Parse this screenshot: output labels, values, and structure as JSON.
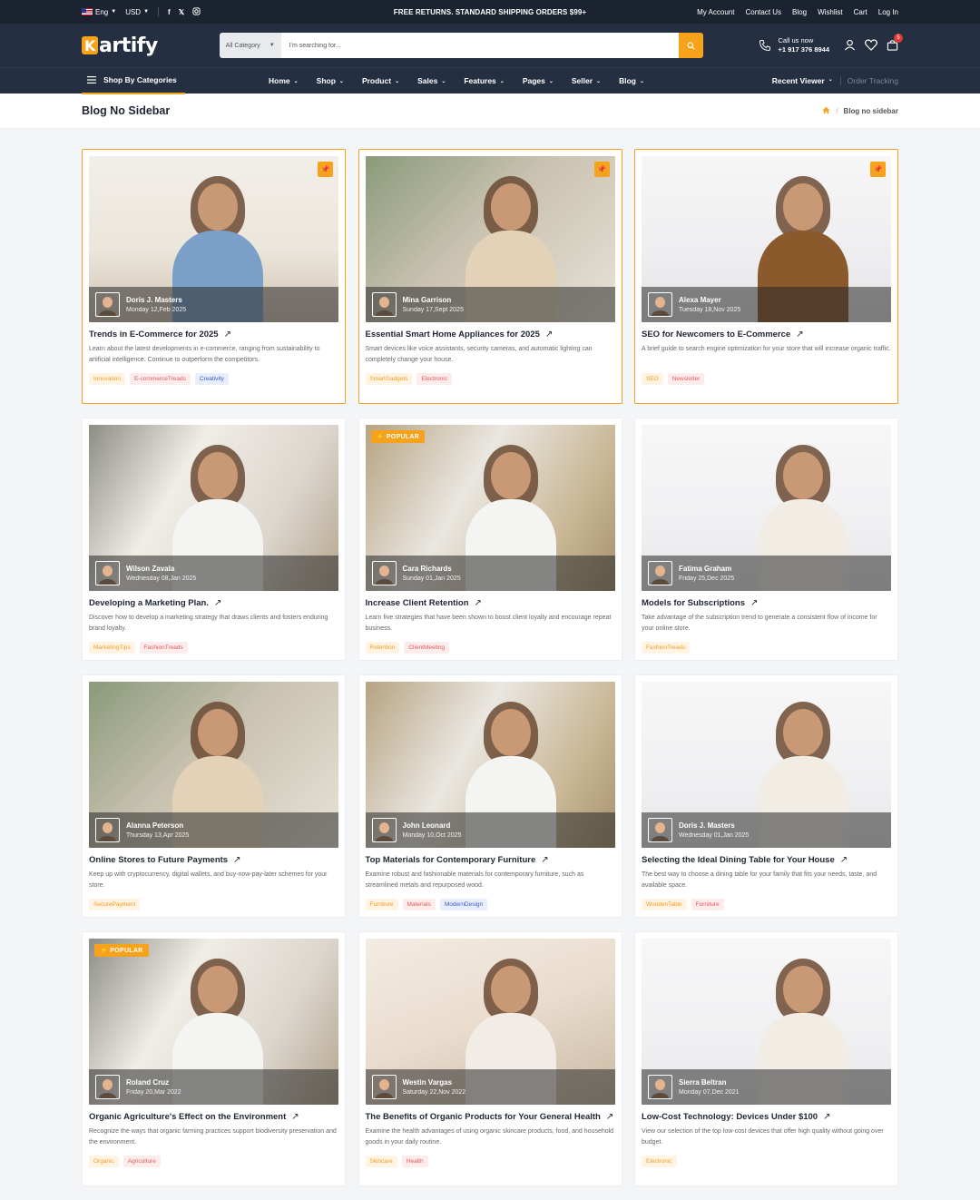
{
  "topbar": {
    "language": "Eng",
    "currency": "USD",
    "promo": "FREE RETURNS. STANDARD SHIPPING ORDERS $99+",
    "links": [
      "My Account",
      "Contact Us",
      "Blog",
      "Wishlist",
      "Cart",
      "Log In"
    ]
  },
  "header": {
    "logo_initial": "K",
    "logo_rest": "artify",
    "search": {
      "category": "All Category",
      "placeholder": "I'm searching for..."
    },
    "call": {
      "label": "Call us now",
      "phone": "+1 917 376 8944"
    },
    "cart_count": "5"
  },
  "nav": {
    "shop_by": "Shop By Categories",
    "items": [
      "Home",
      "Shop",
      "Product",
      "Sales",
      "Features",
      "Pages",
      "Seller",
      "Blog"
    ],
    "recent_viewer": "Recent Viewer",
    "order_tracking": "Order Tracking"
  },
  "page": {
    "title": "Blog No Sidebar",
    "breadcrumb_current": "Blog no sidebar"
  },
  "posts": [
    {
      "author": "Doris J. Masters",
      "date": "Monday 12,Feb 2025",
      "title": "Trends in E-Commerce for 2025",
      "excerpt": "Learn about the latest developments in e-commerce, ranging from sustainability to artificial intelligence. Continue to outperform the competitors.",
      "tags": [
        "Innovation",
        "E-commerceTreads",
        "Creativity"
      ]
    },
    {
      "author": "Mina Garrison",
      "date": "Sunday 17,Sept 2025",
      "title": "Essential Smart Home Appliances for 2025",
      "excerpt": "Smart devices like voice assistants, security cameras, and automatic lighting can completely change your house.",
      "tags": [
        "SmartGadgets",
        "Electronic"
      ]
    },
    {
      "author": "Alexa Mayer",
      "date": "Tuesday 18,Nov 2025",
      "title": "SEO for Newcomers to E-Commerce",
      "excerpt": "A brief guide to search engine optimization for your store that will increase organic traffic.",
      "tags": [
        "SEO",
        "Newsletter"
      ]
    },
    {
      "author": "Wilson Zavala",
      "date": "Wednesday 08,Jan 2025",
      "title": "Developing a Marketing Plan.",
      "excerpt": "Discover how to develop a marketing strategy that draws clients and fosters enduring brand loyalty.",
      "tags": [
        "MarketingTips",
        "FashionTreads"
      ]
    },
    {
      "author": "Cara Richards",
      "date": "Sunday 01,Jan 2025",
      "title": "Increase Client Retention",
      "excerpt": "Learn five strategies that have been shown to boost client loyalty and encourage repeat business.",
      "tags": [
        "Retention",
        "ClientMeeting"
      ],
      "badge": "POPULAR"
    },
    {
      "author": "Fatima Graham",
      "date": "Friday 25,Dec 2025",
      "title": "Models for Subscriptions",
      "excerpt": "Take advantage of the subscription trend to generate a consistent flow of income for your online store.",
      "tags": [
        "FashionTreads"
      ]
    },
    {
      "author": "Alanna Peterson",
      "date": "Thursday 13,Apr 2025",
      "title": "Online Stores to Future Payments",
      "excerpt": "Keep up with cryptocurrency, digital wallets, and buy-now-pay-later schemes for your store.",
      "tags": [
        "SecurePayment"
      ]
    },
    {
      "author": "John Leonard",
      "date": "Monday 10,Oct 2025",
      "title": "Top Materials for Contemporary Furniture",
      "excerpt": "Examine robust and fashionable materials for contemporary furniture, such as streamlined metals and repurposed wood.",
      "tags": [
        "Furniture",
        "Materials",
        "ModernDesign"
      ]
    },
    {
      "author": "Doris J. Masters",
      "date": "Wednesday 01,Jan 2025",
      "title": "Selecting the Ideal Dining Table for Your House",
      "excerpt": "The best way to choose a dining table for your family that fits your needs, taste, and available space.",
      "tags": [
        "WoodenTable",
        "Furniture"
      ]
    },
    {
      "author": "Roland Cruz",
      "date": "Friday 20,Mar 2022",
      "title": "Organic Agriculture's Effect on the Environment",
      "excerpt": "Recognize the ways that organic farming practices support biodiversity preservation and the environment.",
      "tags": [
        "Organic",
        "Agriculture"
      ],
      "badge": "POPULAR"
    },
    {
      "author": "Westin Vargas",
      "date": "Saturday 22,Nov 2022",
      "title": "The Benefits of Organic Products for Your General Health",
      "excerpt": "Examine the health advantages of using organic skincare products, food, and household goods in your daily routine.",
      "tags": [
        "Skincare",
        "Health"
      ]
    },
    {
      "author": "Sierra Beltran",
      "date": "Monday 07,Dec 2021",
      "title": "Low-Cost Technology: Devices Under $100",
      "excerpt": "View our selection of the top low-cost devices that offer high quality without going over budget.",
      "tags": [
        "Electronic"
      ]
    }
  ],
  "colors": {
    "accent": "#f7a21b",
    "header": "#243041",
    "topbar": "#1b2330"
  }
}
